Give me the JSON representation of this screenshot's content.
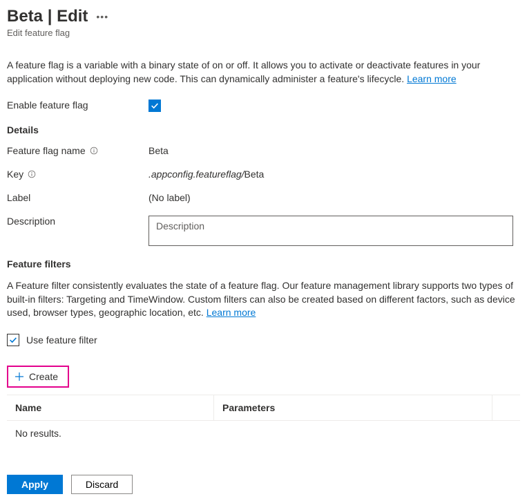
{
  "header": {
    "title": "Beta | Edit",
    "subtitle": "Edit feature flag"
  },
  "intro": {
    "text": "A feature flag is a variable with a binary state of on or off. It allows you to activate or deactivate features in your application without deploying new code. This can dynamically administer a feature's lifecycle. ",
    "learn_more": "Learn more"
  },
  "enable": {
    "label": "Enable feature flag"
  },
  "details": {
    "section": "Details",
    "name_label": "Feature flag name",
    "name_value": "Beta",
    "key_label": "Key",
    "key_prefix": ".appconfig.featureflag/",
    "key_value": "Beta",
    "label_label": "Label",
    "label_value": "(No label)",
    "description_label": "Description",
    "description_placeholder": "Description"
  },
  "filters": {
    "section": "Feature filters",
    "desc": "A Feature filter consistently evaluates the state of a feature flag. Our feature management library supports two types of built-in filters: Targeting and TimeWindow. Custom filters can also be created based on different factors, such as device used, browser types, geographic location, etc. ",
    "learn_more": "Learn more",
    "use_filter_label": "Use feature filter",
    "create_label": "Create",
    "table": {
      "col_name": "Name",
      "col_params": "Parameters",
      "no_results": "No results."
    }
  },
  "footer": {
    "apply": "Apply",
    "discard": "Discard"
  }
}
